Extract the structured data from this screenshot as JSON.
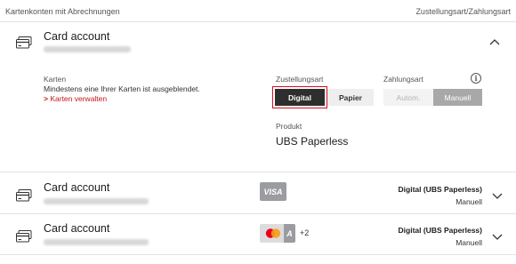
{
  "header": {
    "left": "Kartenkonten mit Abrechnungen",
    "right": "Zustellungsart/Zahlungsart"
  },
  "account1": {
    "title": "Card account",
    "cards_label": "Karten",
    "cards_note": "Mindestens eine Ihrer Karten ist ausgeblendet.",
    "manage_link": "Karten verwalten",
    "delivery_label": "Zustellungsart",
    "delivery_options": [
      "Digital",
      "Papier"
    ],
    "delivery_selected": "Digital",
    "payment_label": "Zahlungsart",
    "payment_options": [
      "Autom.",
      "Manuell"
    ],
    "payment_selected": "Manuell",
    "product_label": "Produkt",
    "product_value": "UBS Paperless"
  },
  "account2": {
    "title": "Card account",
    "card_brand": "VISA",
    "delivery": "Digital (UBS Paperless)",
    "payment": "Manuell"
  },
  "account3": {
    "title": "Card account",
    "card_extra": "A",
    "more_cards": "+2",
    "delivery": "Digital (UBS Paperless)",
    "payment": "Manuell"
  },
  "colors": {
    "accent_red": "#d10f1f",
    "selected_dark": "#2e2e2e",
    "selected_gray": "#a8a8a8"
  }
}
